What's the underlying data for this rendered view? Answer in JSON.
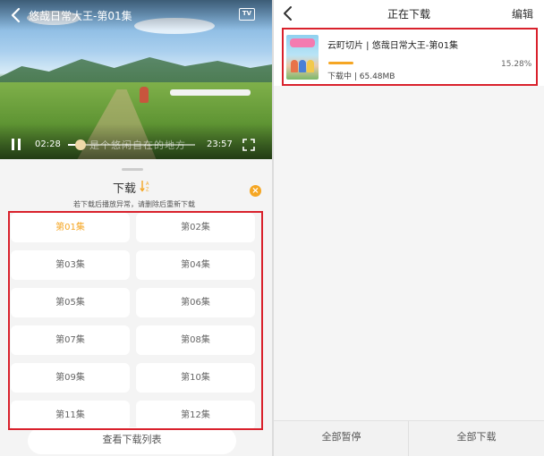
{
  "player": {
    "title": "悠哉日常大王-第01集",
    "tv_badge": "TV",
    "current_time": "02:28",
    "total_time": "23:57",
    "progress": 0.1,
    "subtitle": "是个悠闲自在的地方"
  },
  "download_sheet": {
    "title": "下载",
    "hint": "若下载后播放异常，请删除后重新下载",
    "close_glyph": "×",
    "episodes": [
      {
        "label": "第01集",
        "active": true
      },
      {
        "label": "第02集",
        "active": false
      },
      {
        "label": "第03集",
        "active": false
      },
      {
        "label": "第04集",
        "active": false
      },
      {
        "label": "第05集",
        "active": false
      },
      {
        "label": "第06集",
        "active": false
      },
      {
        "label": "第07集",
        "active": false
      },
      {
        "label": "第08集",
        "active": false
      },
      {
        "label": "第09集",
        "active": false
      },
      {
        "label": "第10集",
        "active": false
      },
      {
        "label": "第11集",
        "active": false
      },
      {
        "label": "第12集",
        "active": false
      }
    ],
    "view_list_label": "查看下载列表",
    "accent_color": "#f5a623"
  },
  "downloads": {
    "title": "正在下载",
    "edit_label": "编辑",
    "items": [
      {
        "name": "云町切片 | 悠哉日常大王-第01集",
        "status": "下载中 | 65.48MB",
        "percent": "15.28%",
        "progress": 0.1528
      }
    ],
    "pause_all_label": "全部暂停",
    "download_all_label": "全部下载"
  },
  "highlight_color": "#d9212c"
}
